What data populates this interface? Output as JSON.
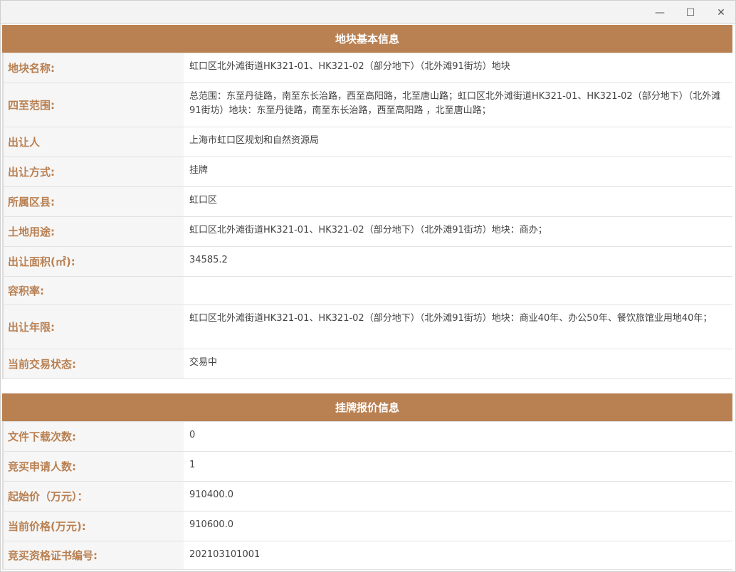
{
  "window": {
    "minimize": "—",
    "maximize": "☐",
    "close": "✕"
  },
  "sections": [
    {
      "title": "地块基本信息",
      "rows": [
        {
          "label": "地块名称:",
          "value": "虹口区北外滩街道HK321-01、HK321-02（部分地下）（北外滩91街坊）地块"
        },
        {
          "label": "四至范围:",
          "value": "总范围：东至丹徒路，南至东长治路，西至高阳路，北至唐山路；虹口区北外滩街道HK321-01、HK321-02（部分地下）（北外滩91街坊）地块：东至丹徒路，南至东长治路，西至高阳路 ，北至唐山路；"
        },
        {
          "label": "出让人",
          "value": "上海市虹口区规划和自然资源局"
        },
        {
          "label": "出让方式:",
          "value": "挂牌"
        },
        {
          "label": "所属区县:",
          "value": "虹口区"
        },
        {
          "label": "土地用途:",
          "value": "虹口区北外滩街道HK321-01、HK321-02（部分地下）（北外滩91街坊）地块：商办；"
        },
        {
          "label": "出让面积(㎡):",
          "value": "34585.2"
        },
        {
          "label": "容积率:",
          "value": ""
        },
        {
          "label": "出让年限:",
          "value": "虹口区北外滩街道HK321-01、HK321-02（部分地下）（北外滩91街坊）地块：商业40年、办公50年、餐饮旅馆业用地40年；"
        },
        {
          "label": "当前交易状态:",
          "value": "交易中"
        }
      ]
    },
    {
      "title": "挂牌报价信息",
      "rows": [
        {
          "label": "文件下载次数:",
          "value": "0"
        },
        {
          "label": "竞买申请人数:",
          "value": "1"
        },
        {
          "label": "起始价（万元）：",
          "value": "910400.0"
        },
        {
          "label": "当前价格(万元):",
          "value": "910600.0"
        },
        {
          "label": "竞买资格证书编号:",
          "value": "202103101001"
        }
      ]
    }
  ]
}
